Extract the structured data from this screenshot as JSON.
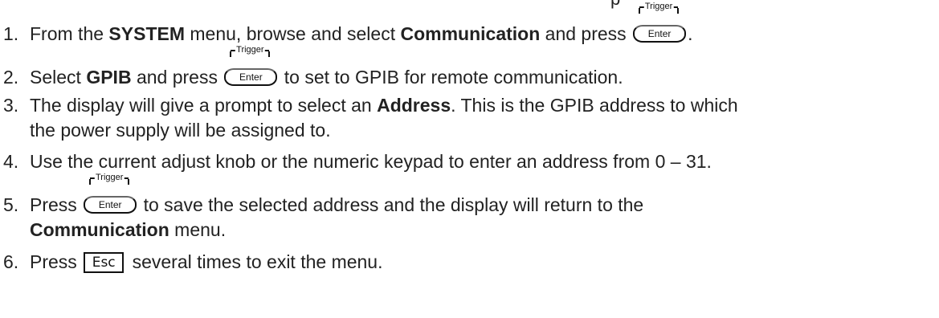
{
  "top_fragment": "p",
  "keys": {
    "trigger_label": "Trigger",
    "enter_label": "Enter",
    "esc_label": "Esc"
  },
  "steps": [
    {
      "num": "1.",
      "t1": "From the ",
      "b1": "SYSTEM",
      "t2": " menu, browse and select ",
      "b2": "Communication",
      "t3": " and press ",
      "t4": "."
    },
    {
      "num": "2.",
      "t1": "Select ",
      "b1": "GPIB",
      "t2": " and press ",
      "t3": " to set to GPIB for remote communication."
    },
    {
      "num": "3.",
      "t1": "The display will give a prompt to select an ",
      "b1": "Address",
      "t2": ".  This is the GPIB address to which",
      "line2": "the power supply will be assigned to."
    },
    {
      "num": "4.",
      "t1": "Use the current adjust knob or the numeric keypad to enter an address from 0 – 31."
    },
    {
      "num": "5.",
      "t1": "Press ",
      "t2": " to save the selected address and the display will return to the",
      "b1": "Communication",
      "t3": " menu."
    },
    {
      "num": "6.",
      "t1": "Press ",
      "t2": " several times to exit the menu."
    }
  ]
}
